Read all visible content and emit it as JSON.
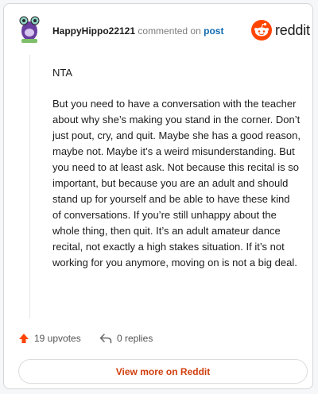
{
  "header": {
    "username": "HappyHippo22121",
    "commented_text": "commented on",
    "post_link": "post",
    "brand": "reddit"
  },
  "comment": {
    "paragraphs": [
      "NTA",
      "But you need to have a conversation with the teacher about why she’s making you stand in the corner. Don’t just pout, cry, and quit. Maybe she has a good reason, maybe not. Maybe it’s a weird misunderstanding. But you need to at least ask. Not because this recital is so important, but because you are an adult and should stand up for yourself and be able to have these kind of conversations. If you’re still unhappy about the whole thing, then quit. It’s an adult amateur dance recital, not exactly a high stakes situation. If it’s not working for you anymore, moving on is not a big deal."
    ]
  },
  "footer": {
    "upvotes": "19 upvotes",
    "replies": "0 replies",
    "view_more": "View more on Reddit"
  },
  "colors": {
    "accent": "#ff4500",
    "link": "#0e6ab0",
    "button_text": "#d13f0e"
  }
}
